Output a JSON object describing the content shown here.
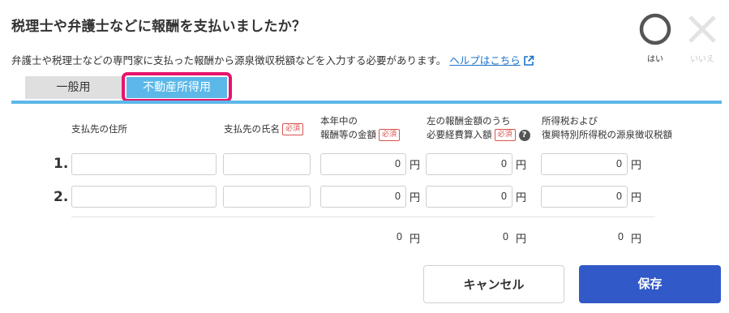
{
  "title": "税理士や弁護士などに報酬を支払いましたか？",
  "description": "弁護士や税理士などの専門家に支払った報酬から源泉徴収税額などを入力する必要があります。",
  "help_link": "ヘルプはこちら",
  "answer": {
    "yes_label": "はい",
    "no_label": "いいえ",
    "selected": "はい"
  },
  "tabs": [
    {
      "label": "一般用",
      "active": false
    },
    {
      "label": "不動産所得用",
      "active": true
    }
  ],
  "columns": {
    "address": "支払先の住所",
    "name": "支払先の氏名",
    "amount_line1": "本年中の",
    "amount_line2": "報酬等の金額",
    "expense_line1": "左の報酬金額のうち",
    "expense_line2": "必要経費算入額",
    "tax_line1": "所得税および",
    "tax_line2": "復興特別所得税の源泉徴収税額",
    "required_badge": "必須"
  },
  "rows": [
    {
      "number": "1.",
      "address": "",
      "name": "",
      "amount": "0",
      "expense": "0",
      "tax": "0"
    },
    {
      "number": "2.",
      "address": "",
      "name": "",
      "amount": "0",
      "expense": "0",
      "tax": "0"
    }
  ],
  "unit": "円",
  "totals": {
    "amount": "0",
    "expense": "0",
    "tax": "0"
  },
  "buttons": {
    "cancel": "キャンセル",
    "save": "保存"
  },
  "colors": {
    "accent": "#5cb8e8",
    "highlight": "#e8146a",
    "primary_button": "#3159c8",
    "required": "#d9534f"
  }
}
